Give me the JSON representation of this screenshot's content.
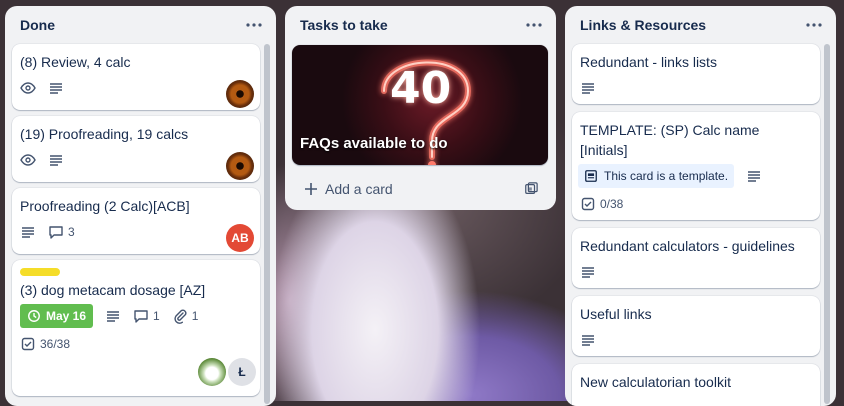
{
  "lists": [
    {
      "title": "Done",
      "cards": [
        {
          "title": "(8) Review, 4 calc"
        },
        {
          "title": "(19) Proofreading, 19 calcs"
        },
        {
          "title": "Proofreading (2 Calc)[ACB]",
          "comments": "3",
          "avatar_initials": "AB"
        },
        {
          "title": "(3) dog metacam dosage [AZ]",
          "label_color": "#f5dd29",
          "due": "May 16",
          "comments": "1",
          "attachments": "1",
          "checklist": "36/38",
          "avatar_initials": "Ł"
        }
      ]
    },
    {
      "title": "Tasks to take",
      "cards": [
        {
          "title": "FAQs available to do",
          "cover_text": "40"
        }
      ],
      "add_card_label": "Add a card"
    },
    {
      "title": "Links & Resources",
      "cards": [
        {
          "title": "Redundant - links lists"
        },
        {
          "title": "TEMPLATE: (SP) Calc name [Initials]",
          "template_text": "This card is a template.",
          "checklist": "0/38"
        },
        {
          "title": "Redundant calculators - guidelines"
        },
        {
          "title": "Useful links"
        },
        {
          "title": "New calculatorian toolkit"
        }
      ]
    }
  ],
  "icons": {
    "menu": "ellipsis-icon",
    "watch": "eye-icon",
    "description": "description-icon",
    "comment": "comment-icon",
    "attachment": "paperclip-icon",
    "checklist": "checklist-icon",
    "clock": "clock-icon",
    "template": "template-icon",
    "add": "plus-icon",
    "create_from_template": "template-create-icon"
  },
  "colors": {
    "due_complete": "#61bd4f",
    "label_yellow": "#f5dd29",
    "avatar_ab": "#e34935",
    "template_badge_bg": "#e9f2ff"
  }
}
